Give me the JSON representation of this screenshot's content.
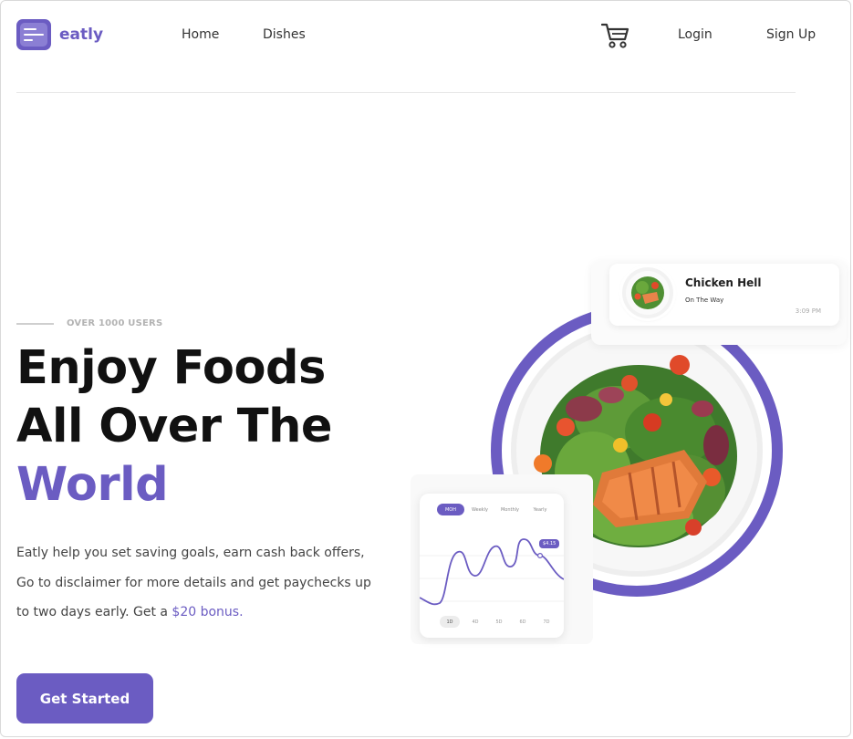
{
  "brand": {
    "name": "eatly",
    "accent": "#6b5cc2"
  },
  "nav": {
    "home": "Home",
    "dishes": "Dishes",
    "login": "Login",
    "signup": "Sign Up",
    "cart_icon": "cart-icon"
  },
  "hero": {
    "eyebrow": "OVER 1000 USERS",
    "title_line1": "Enjoy Foods",
    "title_line2": "All Over The",
    "title_accent": "World",
    "desc_line1": "Eatly help you set saving goals, earn cash back offers,",
    "desc_line2": "Go to disclaimer for more details and get paychecks up",
    "desc_line3_pre": "to two days early. Get a ",
    "desc_bonus": "$20 bonus.",
    "cta": "Get Started"
  },
  "notification": {
    "title": "Chicken Hell",
    "status": "On The Way",
    "time": "3:09 PM"
  },
  "chart_card": {
    "tabs": [
      "MOH",
      "Weekly",
      "Monthly",
      "Yearly"
    ],
    "pill": "$4.15",
    "x_labels": [
      "1D",
      "4D",
      "5D",
      "6D",
      "7D"
    ]
  }
}
